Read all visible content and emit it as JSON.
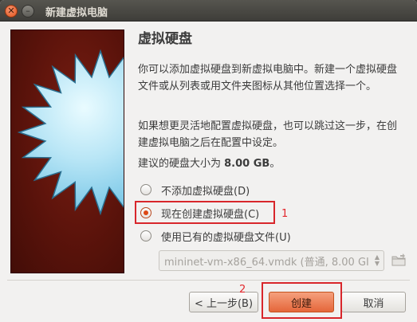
{
  "window": {
    "title": "新建虚拟电脑",
    "close_glyph": "✕",
    "minimize_glyph": "–"
  },
  "content": {
    "heading": "虚拟硬盘",
    "paragraph1": "你可以添加虚拟硬盘到新虚拟电脑中。新建一个虚拟硬盘文件或从列表或用文件夹图标从其他位置选择一个。",
    "paragraph2": "如果想更灵活地配置虚拟硬盘，也可以跳过这一步，在创建虚拟电脑之后在配置中设定。",
    "size_prefix": "建议的硬盘大小为 ",
    "size_value": "8.00 GB",
    "size_suffix": "。"
  },
  "options": [
    {
      "label": "不添加虚拟硬盘(D)",
      "checked": false
    },
    {
      "label": "现在创建虚拟硬盘(C)",
      "checked": true
    },
    {
      "label": "使用已有的虚拟硬盘文件(U)",
      "checked": false
    }
  ],
  "disk_combo": {
    "value": "mininet-vm-x86_64.vmdk (普通, 8.00 GI",
    "enabled": false
  },
  "buttons": {
    "back": "< 上一步(B)",
    "create": "创建",
    "cancel": "取消"
  },
  "annotations": {
    "mark1": "1",
    "mark2": "2",
    "color": "#e2262b"
  },
  "colors": {
    "accent": "#dd4814",
    "titlebar": "#3e3d39",
    "background": "#f2f1f0"
  }
}
